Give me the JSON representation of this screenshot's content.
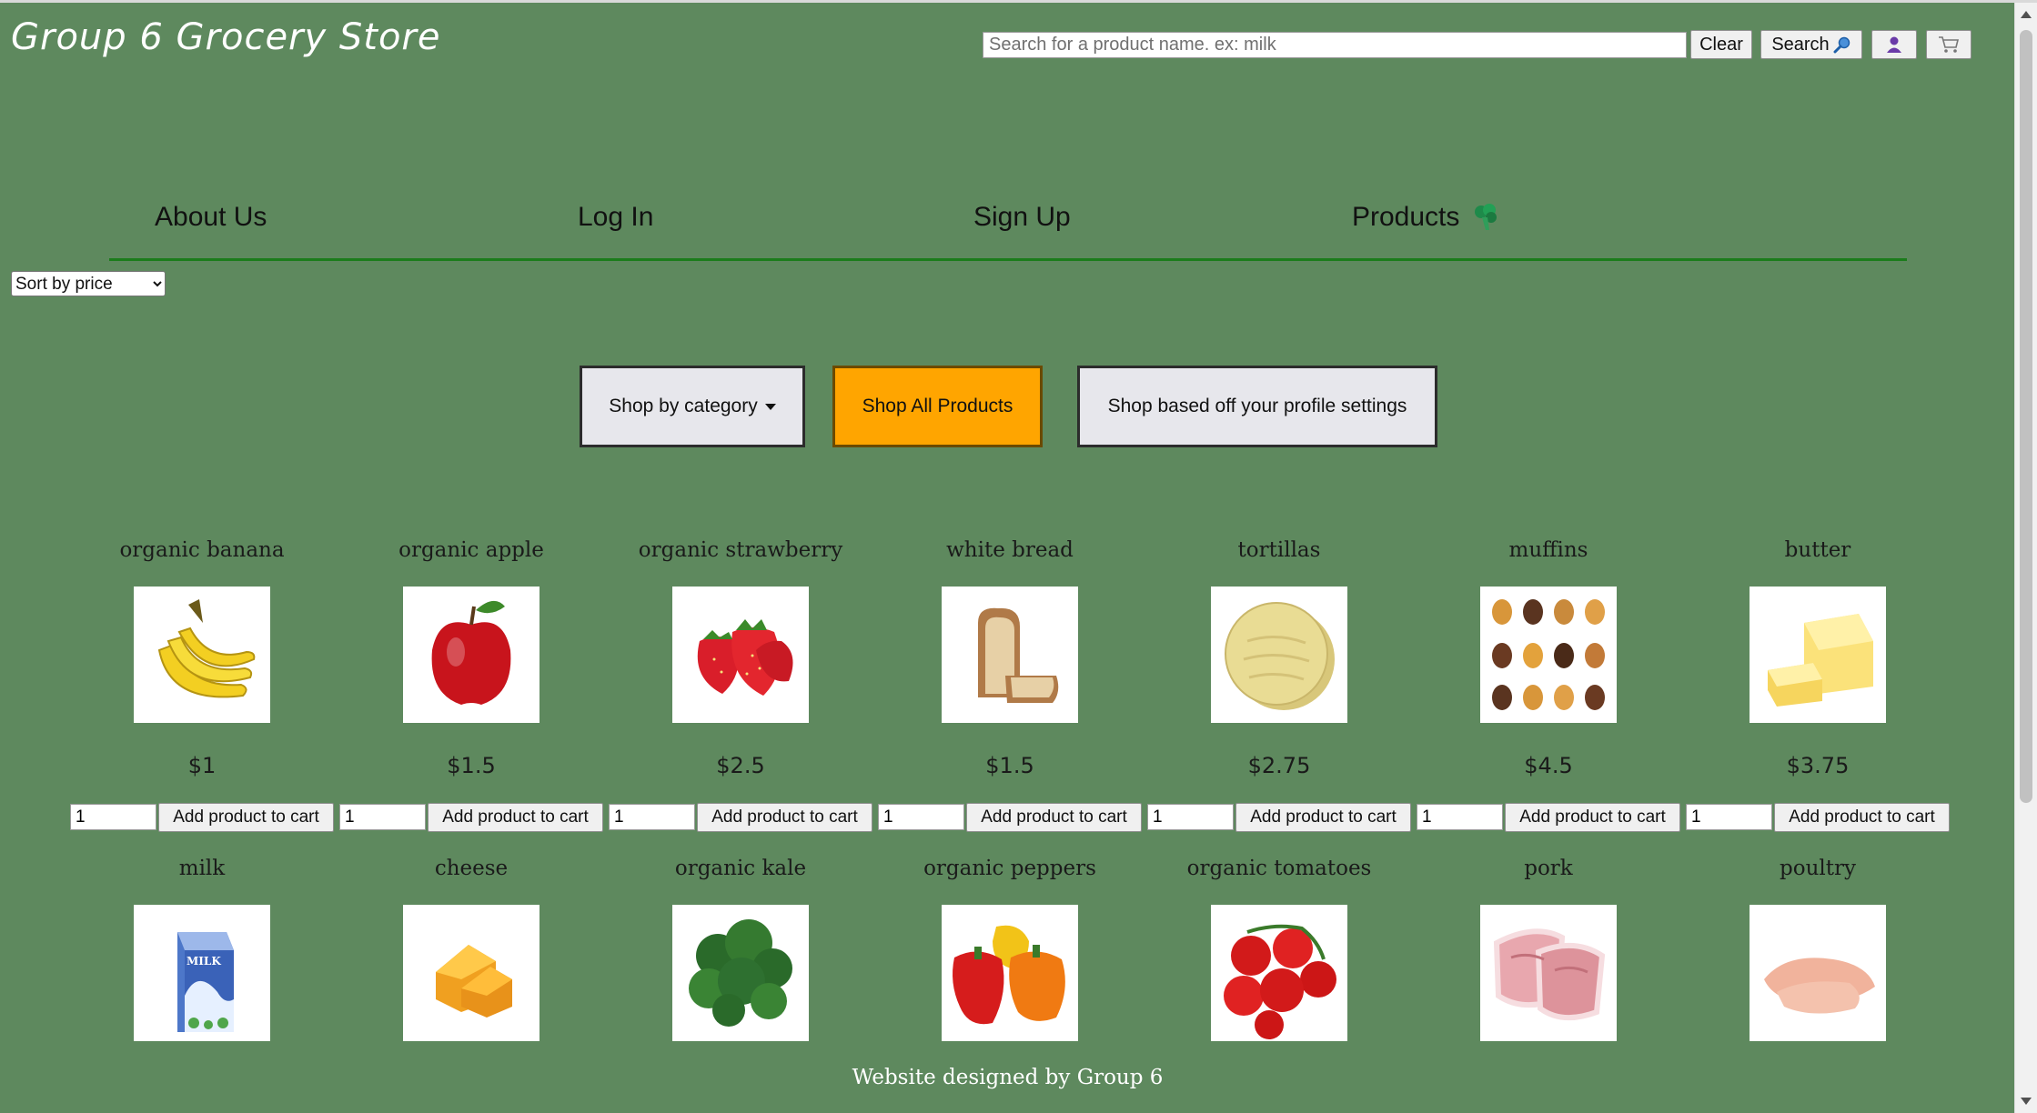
{
  "header": {
    "site_title": "Group 6 Grocery Store",
    "search_placeholder": "Search for a product name. ex: milk",
    "search_value": "",
    "clear_label": "Clear",
    "search_label": "Search",
    "search_icon": "magnifier-icon",
    "user_icon": "user-icon",
    "cart_icon": "cart-icon"
  },
  "nav": {
    "about": "About Us",
    "login": "Log In",
    "signup": "Sign Up",
    "products": "Products",
    "products_icon": "broccoli-icon"
  },
  "sort": {
    "selected": "Sort by price"
  },
  "categories": {
    "by_category": "Shop by category",
    "all_products": "Shop All Products",
    "profile": "Shop based off your profile settings",
    "active_color": "#ffa500"
  },
  "products": [
    {
      "name": "organic banana",
      "price": "$1",
      "qty": "1",
      "button": "Add product to cart",
      "icon": "banana-icon"
    },
    {
      "name": "organic apple",
      "price": "$1.5",
      "qty": "1",
      "button": "Add product to cart",
      "icon": "apple-icon"
    },
    {
      "name": "organic strawberry",
      "price": "$2.5",
      "qty": "1",
      "button": "Add product to cart",
      "icon": "strawberry-icon"
    },
    {
      "name": "white bread",
      "price": "$1.5",
      "qty": "1",
      "button": "Add product to cart",
      "icon": "bread-icon"
    },
    {
      "name": "tortillas",
      "price": "$2.75",
      "qty": "1",
      "button": "Add product to cart",
      "icon": "tortilla-icon"
    },
    {
      "name": "muffins",
      "price": "$4.5",
      "qty": "1",
      "button": "Add product to cart",
      "icon": "muffins-icon"
    },
    {
      "name": "butter",
      "price": "$3.75",
      "qty": "1",
      "button": "Add product to cart",
      "icon": "butter-icon"
    },
    {
      "name": "milk",
      "icon": "milk-carton-icon",
      "carton_label": "MILK"
    },
    {
      "name": "cheese",
      "icon": "cheese-icon"
    },
    {
      "name": "organic kale",
      "icon": "kale-icon"
    },
    {
      "name": "organic peppers",
      "icon": "peppers-icon"
    },
    {
      "name": "organic tomatoes",
      "icon": "tomatoes-icon"
    },
    {
      "name": "pork",
      "icon": "pork-icon"
    },
    {
      "name": "poultry",
      "icon": "chicken-icon"
    }
  ],
  "footer": {
    "text": "Website designed by Group 6"
  },
  "colors": {
    "background": "#5e895e",
    "nav_rule": "#1b7c1b"
  }
}
